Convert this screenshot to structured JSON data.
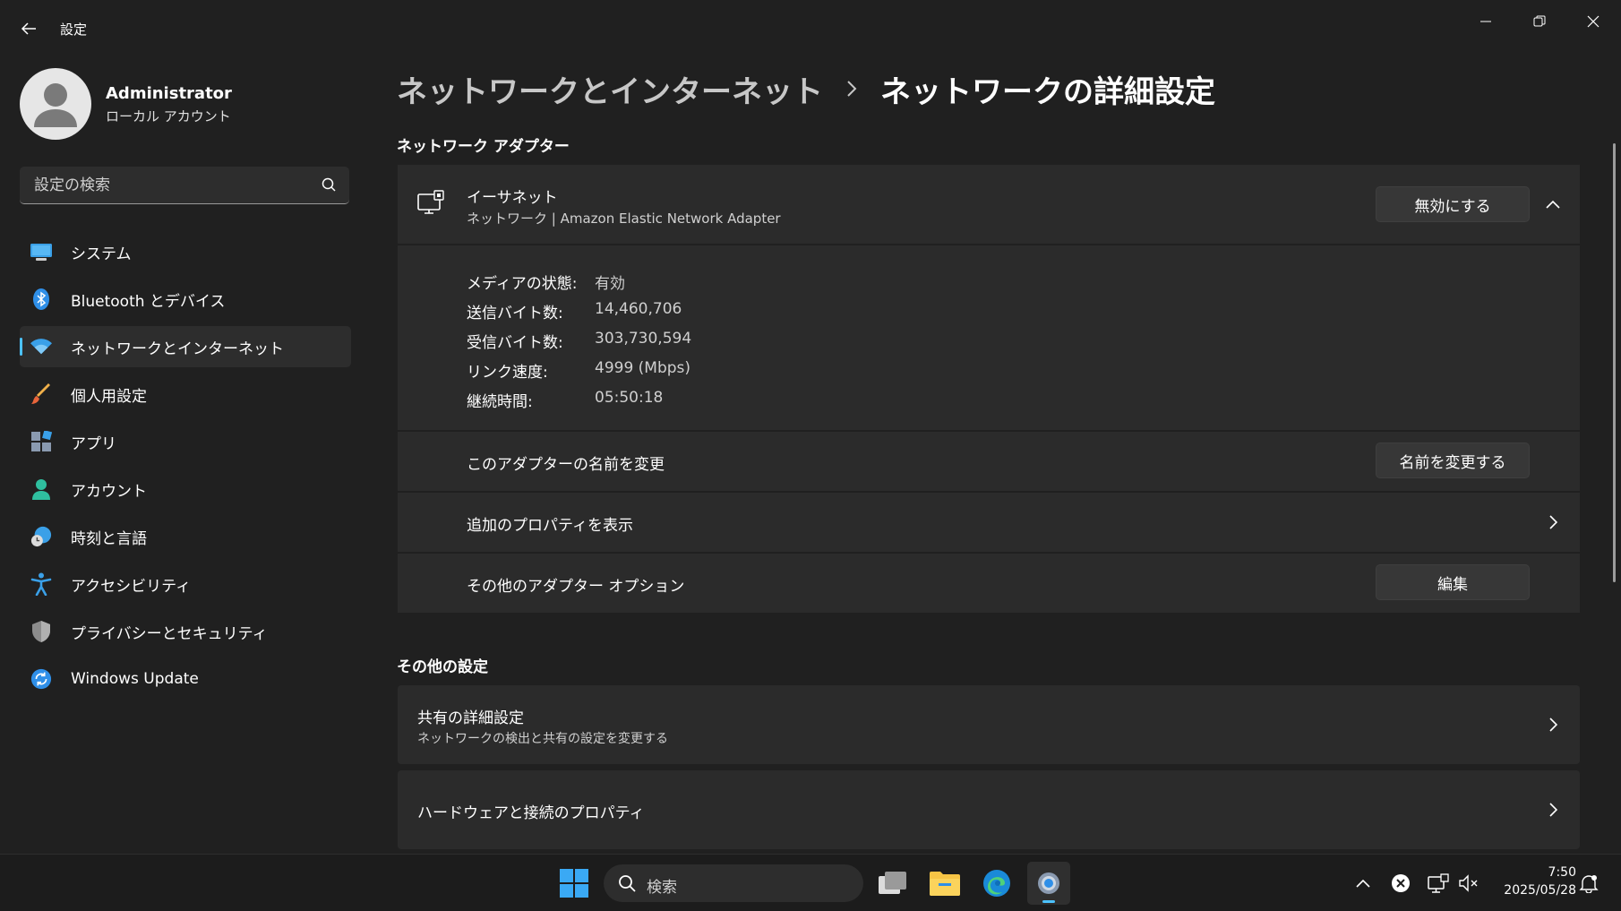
{
  "window": {
    "app_title": "設定"
  },
  "profile": {
    "name": "Administrator",
    "account_type": "ローカル アカウント"
  },
  "search": {
    "placeholder": "設定の検索"
  },
  "nav": {
    "items": [
      {
        "label": "システム",
        "icon": "system-icon",
        "active": false
      },
      {
        "label": "Bluetooth とデバイス",
        "icon": "bluetooth-icon",
        "active": false
      },
      {
        "label": "ネットワークとインターネット",
        "icon": "wifi-icon",
        "active": true
      },
      {
        "label": "個人用設定",
        "icon": "brush-icon",
        "active": false
      },
      {
        "label": "アプリ",
        "icon": "apps-icon",
        "active": false
      },
      {
        "label": "アカウント",
        "icon": "account-icon",
        "active": false
      },
      {
        "label": "時刻と言語",
        "icon": "time-language-icon",
        "active": false
      },
      {
        "label": "アクセシビリティ",
        "icon": "accessibility-icon",
        "active": false
      },
      {
        "label": "プライバシーとセキュリティ",
        "icon": "shield-icon",
        "active": false
      },
      {
        "label": "Windows Update",
        "icon": "update-icon",
        "active": false
      }
    ]
  },
  "breadcrumb": {
    "parent": "ネットワークとインターネット",
    "current": "ネットワークの詳細設定"
  },
  "adapters": {
    "section_title": "ネットワーク アダプター",
    "ethernet": {
      "name": "イーサネット",
      "description": "ネットワーク | Amazon Elastic Network Adapter",
      "disable_button": "無効にする"
    },
    "properties": [
      {
        "label": "メディアの状態:",
        "value": "有効"
      },
      {
        "label": "送信バイト数:",
        "value": "14,460,706"
      },
      {
        "label": "受信バイト数:",
        "value": "303,730,594"
      },
      {
        "label": "リンク速度:",
        "value": "4999 (Mbps)"
      },
      {
        "label": "継続時間:",
        "value": "05:50:18"
      }
    ],
    "rename_label": "このアダプターの名前を変更",
    "rename_button": "名前を変更する",
    "more_properties_label": "追加のプロパティを表示",
    "other_options_label": "その他のアダプター オプション",
    "edit_button": "編集"
  },
  "other_settings": {
    "section_title": "その他の設定",
    "sharing": {
      "title": "共有の詳細設定",
      "subtitle": "ネットワークの検出と共有の設定を変更する"
    },
    "hardware": {
      "title": "ハードウェアと接続のプロパティ"
    }
  },
  "taskbar": {
    "search_label": "検索",
    "time": "7:50",
    "date": "2025/05/28"
  },
  "colors": {
    "accent": "#4cc2ff",
    "background": "#202020",
    "card": "#2b2b2b"
  }
}
